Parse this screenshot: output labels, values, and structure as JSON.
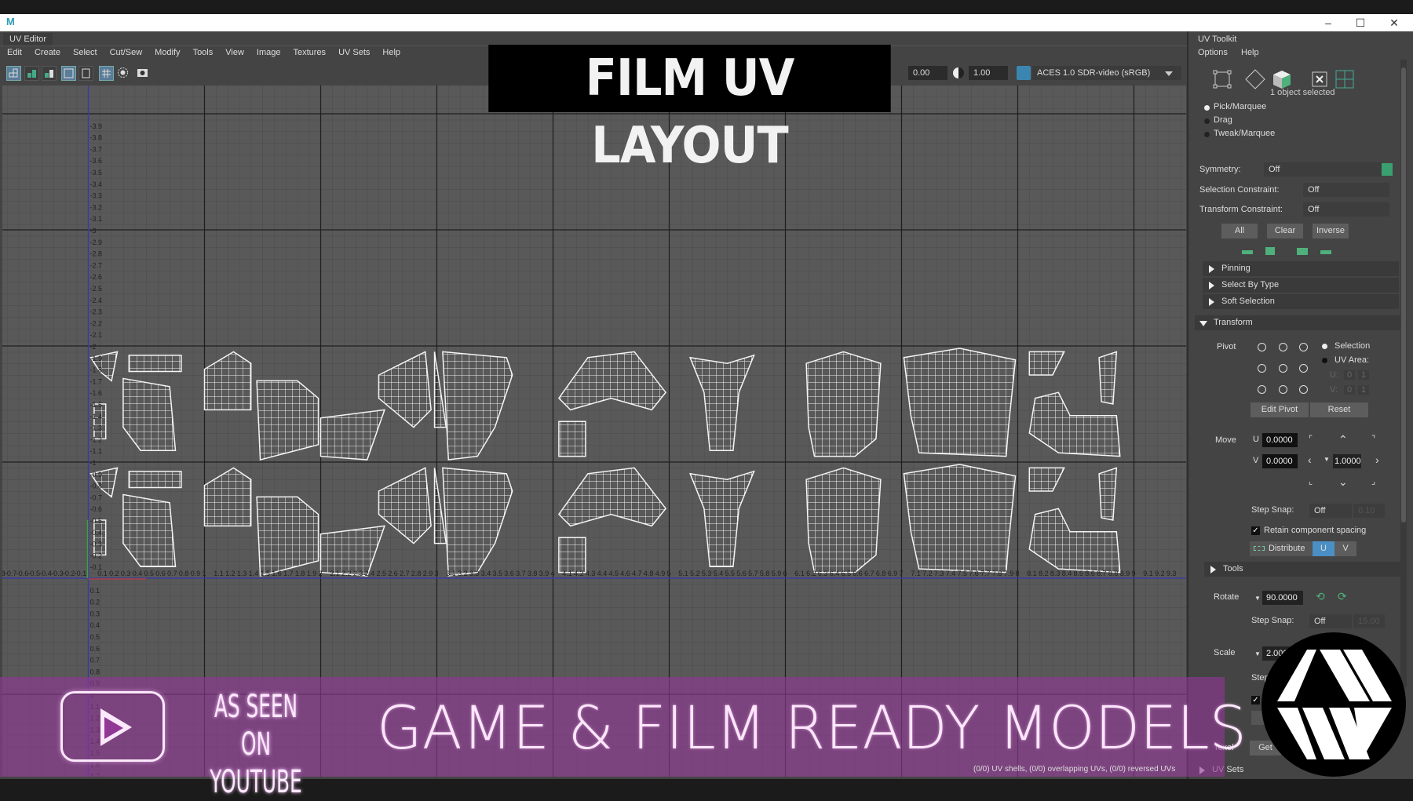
{
  "window": {
    "app_icon": "M",
    "controls": [
      "minimize-icon",
      "maximize-icon",
      "close-icon"
    ]
  },
  "editor": {
    "tab": "UV Editor",
    "menu": [
      "Edit",
      "Create",
      "Select",
      "Cut/Sew",
      "Modify",
      "Tools",
      "View",
      "Image",
      "Textures",
      "UV Sets",
      "Help"
    ],
    "exposure": "0.00",
    "gamma": "1.00",
    "color_space": "ACES 1.0 SDR-video (sRGB)",
    "u_range": [
      -0.8,
      9.3
    ],
    "v_range": [
      -2.0,
      3.9
    ],
    "status": "(0/0) UV shells, (0/0) overlapping UVs, (0/0) reversed UVs"
  },
  "overlay": {
    "title": "FILM UV LAYOUT",
    "as_seen": "AS SEEN ON YOUTUBE",
    "tagline": "GAME & FILM READY MODELS",
    "banner_color": "#91379a"
  },
  "toolkit": {
    "tab": "UV Toolkit",
    "menu": [
      "Options",
      "Help"
    ],
    "selection_info": "1 object selected",
    "modes": [
      {
        "label": "Pick/Marquee",
        "selected": true
      },
      {
        "label": "Drag",
        "selected": false
      },
      {
        "label": "Tweak/Marquee",
        "selected": false
      }
    ],
    "symmetry": {
      "label": "Symmetry:",
      "value": "Off"
    },
    "selection_constraint": {
      "label": "Selection Constraint:",
      "value": "Off"
    },
    "transform_constraint": {
      "label": "Transform Constraint:",
      "value": "Off"
    },
    "buttons": [
      "All",
      "Clear",
      "Inverse"
    ],
    "sections": [
      "Pinning",
      "Select By Type",
      "Soft Selection"
    ],
    "transform": {
      "title": "Transform",
      "pivot_label": "Pivot",
      "pivot_selection": "Selection",
      "pivot_uv_area": "UV Area:",
      "u_label": "U:",
      "v_label": "V:",
      "uv_area": [
        "0",
        "1",
        "0",
        "1"
      ],
      "edit_pivot": "Edit Pivot",
      "reset": "Reset",
      "move_label": "Move",
      "move_u": "0.0000",
      "move_v": "0.0000",
      "move_step": "1.0000",
      "step_snap_label": "Step Snap:",
      "step_snap": "Off",
      "step_snap_value": "0.10",
      "retain_spacing": "Retain component spacing",
      "retain_checked": true,
      "distribute": "Distribute",
      "dist_u": "U",
      "dist_v": "V"
    },
    "tools": {
      "title": "Tools",
      "rotate_label": "Rotate",
      "rotate": "90.0000",
      "rotate_snap": "Off",
      "rotate_snap_value": "15.00",
      "scale_label": "Scale",
      "scale": "2.000",
      "step_label": "Step",
      "texel_label": "Texel",
      "texel_get": "Get"
    },
    "uv_sets": "UV Sets"
  }
}
